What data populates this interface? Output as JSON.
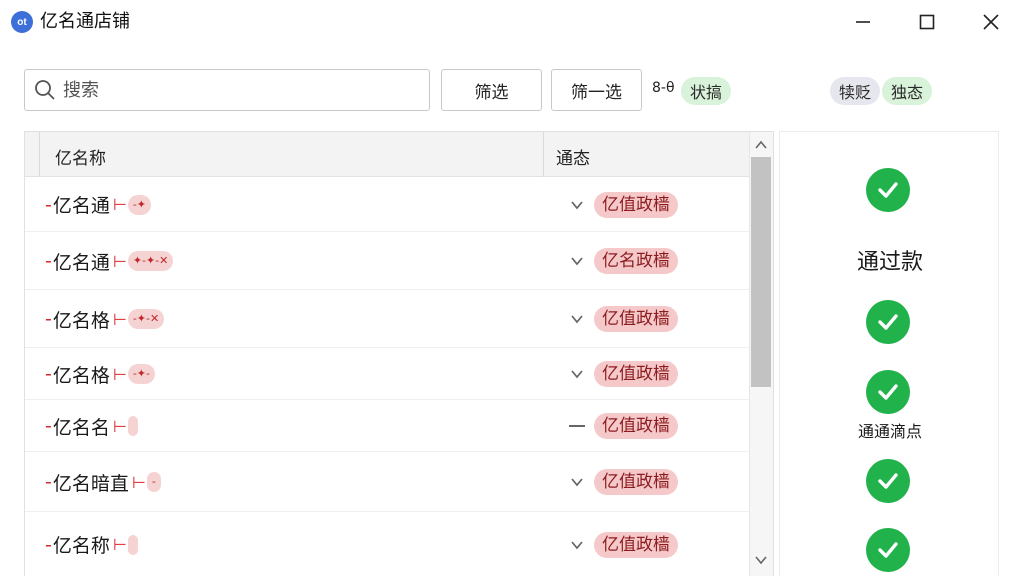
{
  "window": {
    "icon_text": "ot",
    "title": "亿名通店铺"
  },
  "toolbar": {
    "search_placeholder": "搜索",
    "filter_label": "筛选",
    "filter2_label": "筛一选",
    "status_prefix": "8-θ",
    "status_chip": "状搞",
    "chip_a": "犊贬",
    "chip_b": "独态"
  },
  "table": {
    "headers": [
      "亿名称",
      "通态"
    ],
    "rows": [
      {
        "name": "亿名通",
        "tag": "-✦",
        "status": "亿值政樯",
        "expand": "chevron"
      },
      {
        "name": "亿名通",
        "tag": "✦-✦-✕",
        "status": "亿名政樯",
        "expand": "chevron"
      },
      {
        "name": "亿名格",
        "tag": "-✦-✕",
        "status": "亿值政樯",
        "expand": "chevron"
      },
      {
        "name": "亿名格",
        "tag": "-✦-",
        "status": "亿值政樯",
        "expand": "chevron"
      },
      {
        "name": "亿名名",
        "tag": "",
        "status": "亿值政樯",
        "expand": "dash"
      },
      {
        "name": "亿名暗直",
        "tag": "-",
        "status": "亿值政樯",
        "expand": "chevron"
      },
      {
        "name": "亿名称",
        "tag": "",
        "status": "亿值政樯",
        "expand": "chevron"
      }
    ]
  },
  "side_panel": {
    "title": "通过款",
    "subtitle": "通通滴点"
  },
  "colors": {
    "accent": "#3d6fd8",
    "success": "#22b24c",
    "danger_chip": "#f5c9c9",
    "green_chip": "#d9f2da"
  }
}
